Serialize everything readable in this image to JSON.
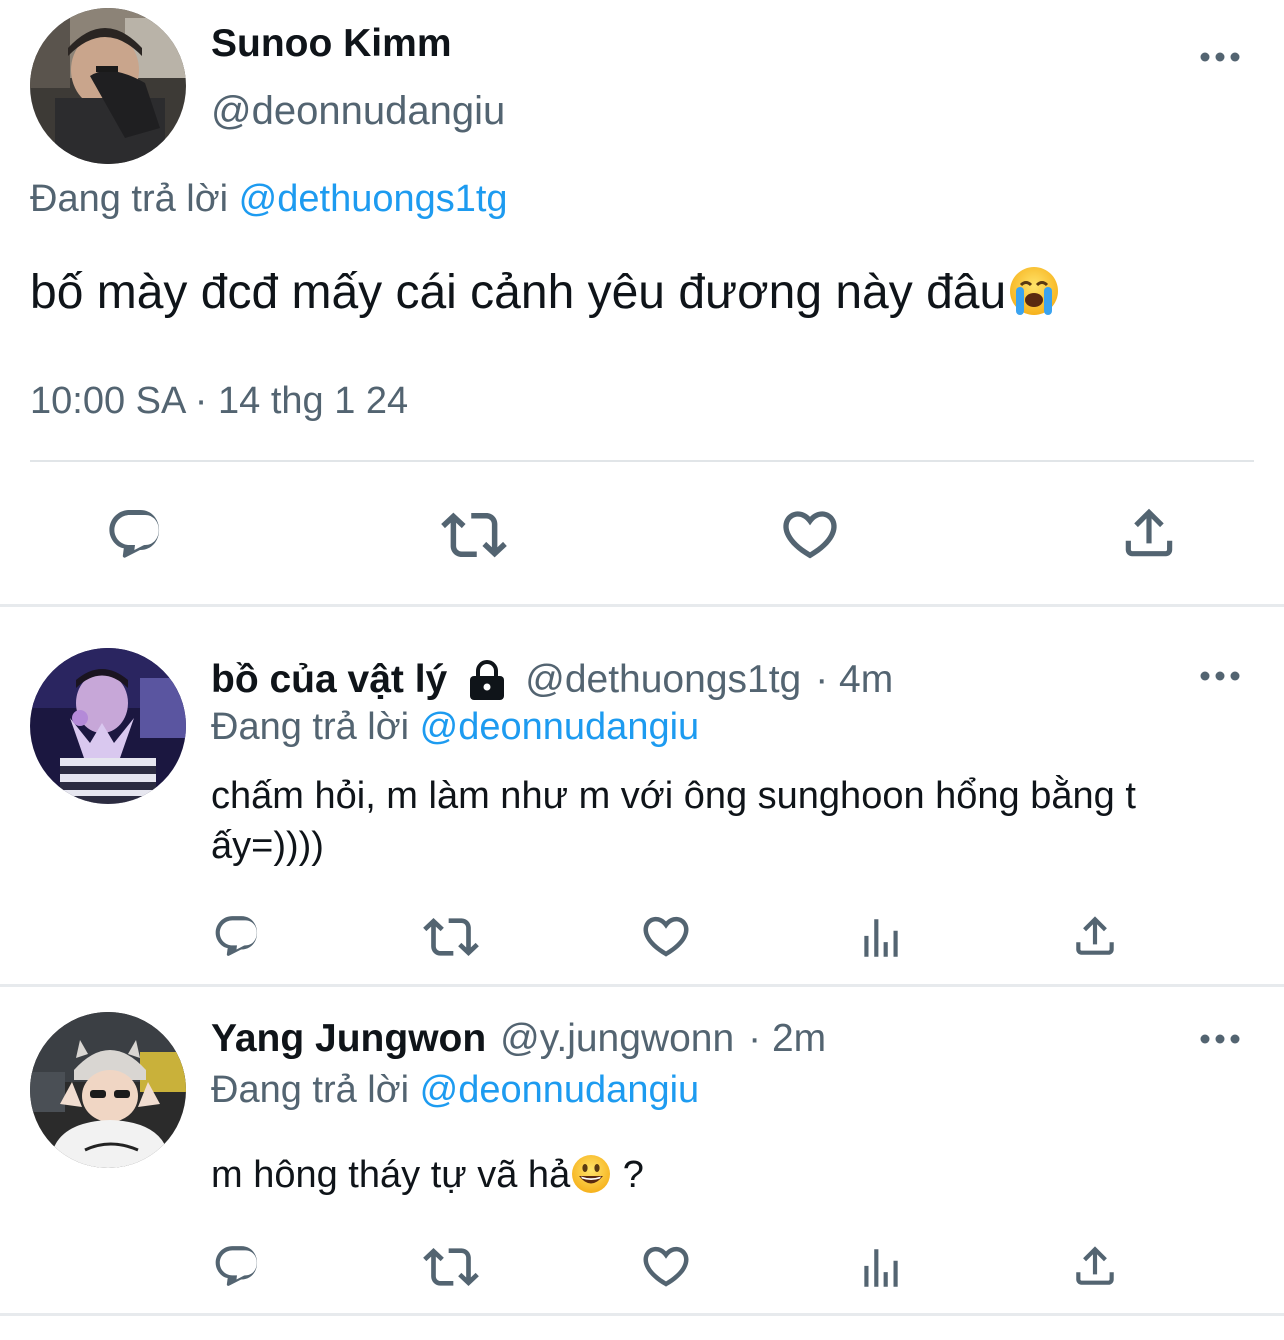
{
  "main_tweet": {
    "display_name": "Sunoo Kimm",
    "handle": "@deonnudangiu",
    "reply_prefix": "Đang trả lời",
    "reply_to": "@dethuongs1tg",
    "text": "bố mày đcđ mấy cái cảnh yêu đương này đâu",
    "emoji": "loudly-crying-face-emoji",
    "timestamp": "10:00 SA · 14 thg 1 24",
    "actions": [
      "reply-icon",
      "retweet-icon",
      "like-icon",
      "share-icon"
    ]
  },
  "replies": [
    {
      "display_name": "bồ của vật lý",
      "protected_icon": "lock-icon",
      "handle": "@dethuongs1tg",
      "time": "· 4m",
      "reply_prefix": "Đang trả lời",
      "reply_to": "@deonnudangiu",
      "text": "chấm hỏi, m làm như m với ông sunghoon hổng bằng t ấy=))))",
      "actions": [
        "reply-icon",
        "retweet-icon",
        "like-icon",
        "analytics-icon",
        "share-icon"
      ]
    },
    {
      "display_name": "Yang Jungwon",
      "handle": "@y.jungwonn",
      "time": "· 2m",
      "reply_prefix": "Đang trả lời",
      "reply_to": "@deonnudangiu",
      "text": "m hông tháy tự vã hả",
      "text_suffix": " ?",
      "emoji": "grinning-face-emoji",
      "actions": [
        "reply-icon",
        "retweet-icon",
        "like-icon",
        "analytics-icon",
        "share-icon"
      ]
    }
  ],
  "colors": {
    "text": "#0f1419",
    "secondary": "#536471",
    "link": "#1d9bf0",
    "icon": "#536471",
    "divider": "#e7eaed"
  }
}
